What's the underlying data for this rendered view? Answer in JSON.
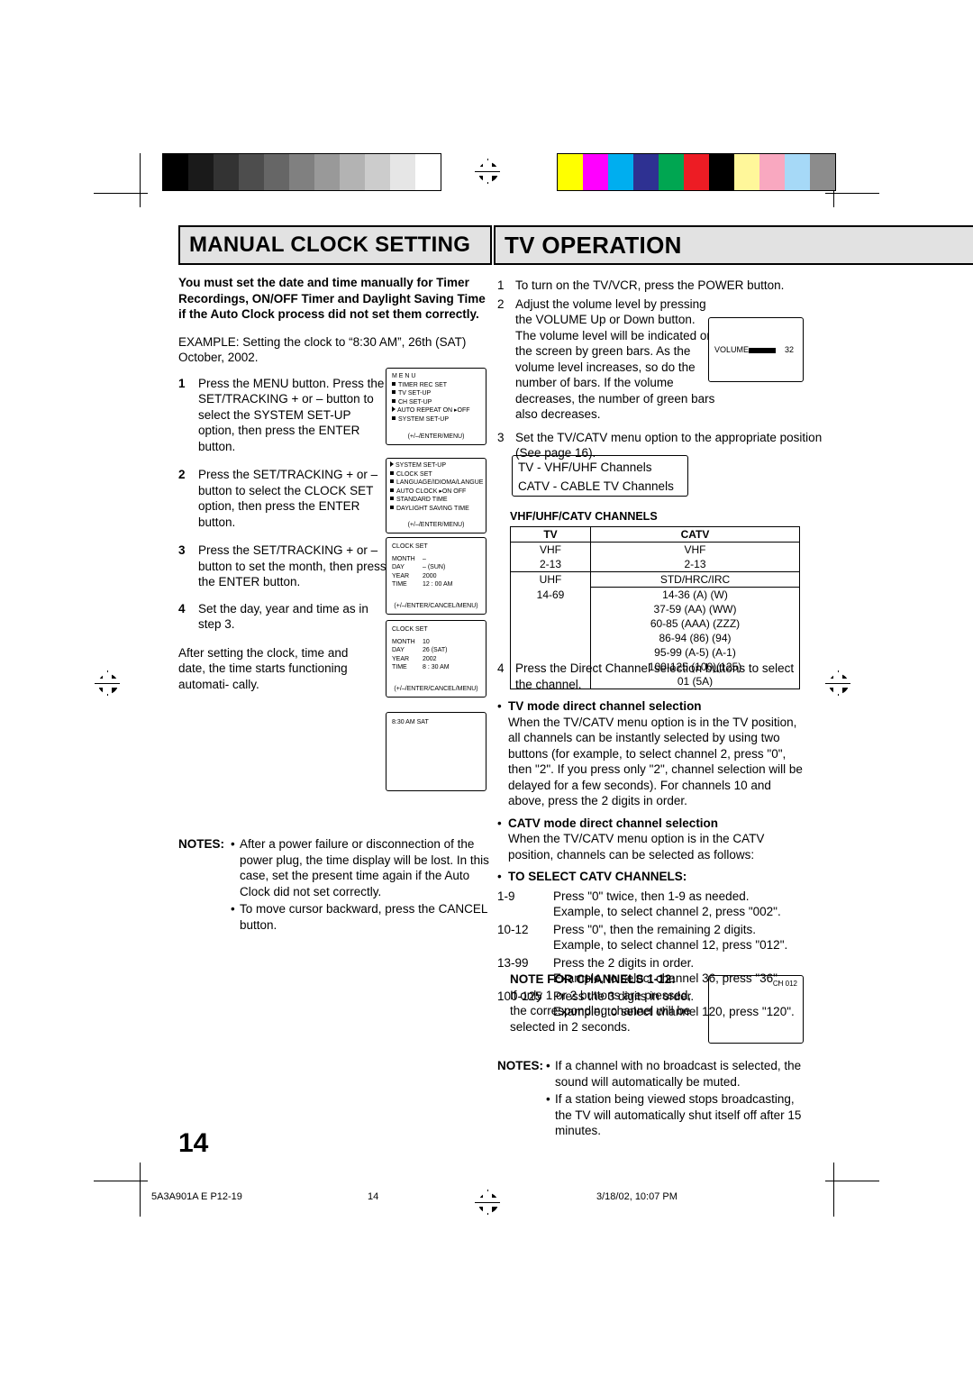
{
  "headers": {
    "left": "MANUAL CLOCK SETTING",
    "right": "TV OPERATION"
  },
  "left_column": {
    "intro": "You must set the date and time manually for Timer Recordings, ON/OFF Timer and Daylight Saving Time if the Auto Clock process did not set them correctly.",
    "example": "EXAMPLE: Setting the clock to “8:30 AM”, 26th (SAT) October, 2002.",
    "steps": [
      {
        "n": "1",
        "text": "Press the MENU button. Press the SET/TRACKING + or – button to select the SYSTEM SET-UP option, then press  the ENTER button."
      },
      {
        "n": "2",
        "text": "Press the SET/TRACKING + or – button to select the CLOCK SET option, then press  the ENTER button."
      },
      {
        "n": "3",
        "text": "Press the SET/TRACKING + or – button to set the month,  then press the ENTER button."
      },
      {
        "n": "4",
        "text": "Set the day, year and time as in step 3."
      }
    ],
    "after": "After setting the clock, time and date, the time starts functioning automati- cally.",
    "notes_label": "NOTES:",
    "notes": [
      "After a power failure or disconnection of the power plug, the time display will be lost. In this case, set the present time again if the Auto Clock did not set correctly.",
      "To move cursor backward, press the CANCEL button."
    ]
  },
  "osd": {
    "menu": {
      "title": "M E N U",
      "lines": [
        "TIMER REC SET",
        "TV SET-UP",
        "CH SET-UP",
        "AUTO REPEAT  ON ▸OFF",
        "SYSTEM  SET-UP"
      ],
      "footer": "(+/–/ENTER/MENU)"
    },
    "system": {
      "title": "SYSTEM  SET-UP",
      "lines": [
        "CLOCK SET",
        "LANGUAGE/IDIOMA/LANGUE",
        "AUTO CLOCK  ▸ON   OFF",
        "STANDARD  TIME",
        "DAYLIGHT  SAVING  TIME"
      ],
      "footer": "(+/–/ENTER/MENU)"
    },
    "clock1": {
      "title": "CLOCK SET",
      "rows": [
        [
          "MONTH",
          "–"
        ],
        [
          "DAY",
          "– (SUN)"
        ],
        [
          "YEAR",
          "2000"
        ],
        [
          "TIME",
          "12 : 00 AM"
        ]
      ],
      "footer": "(+/–/ENTER/CANCEL/MENU)"
    },
    "clock2": {
      "title": "CLOCK SET",
      "rows": [
        [
          "MONTH",
          "10"
        ],
        [
          "DAY",
          "26 (SAT)"
        ],
        [
          "YEAR",
          "2002"
        ],
        [
          "TIME",
          "8 : 30 AM"
        ]
      ],
      "footer": "(+/–/ENTER/CANCEL/MENU)"
    },
    "timeonly": "8:30 AM  SAT"
  },
  "right_column": {
    "steps": [
      {
        "n": "1",
        "text": "To turn on the TV/VCR, press the POWER button."
      },
      {
        "n": "2",
        "text": "Adjust the volume level by pressing the VOLUME Up or Down button. The volume level will be indicated on the screen by green bars. As the volume level increases, so do the number of bars. If the volume decreases, the number of green bars also decreases."
      },
      {
        "n": "3",
        "text": "Set the TV/CATV menu option to the appropriate position (See page 16)."
      }
    ],
    "volume_osd": {
      "label": "VOLUME",
      "value": "32"
    },
    "tv_catv_box": [
      "TV      - VHF/UHF Channels",
      "CATV  - CABLE TV Channels"
    ],
    "table_title": "VHF/UHF/CATV CHANNELS",
    "table": {
      "headers": [
        "TV",
        "CATV"
      ],
      "rows": [
        [
          "VHF",
          "VHF"
        ],
        [
          "2-13",
          "2-13"
        ],
        [
          "UHF",
          "STD/HRC/IRC"
        ],
        [
          "14-69",
          "14-36   (A)  (W)"
        ],
        [
          "",
          "37-59  (AA)  (WW)"
        ],
        [
          "",
          "60-85   (AAA)  (ZZZ)"
        ],
        [
          "",
          "86-94   (86)  (94)"
        ],
        [
          "",
          "95-99   (A-5)  (A-1)"
        ],
        [
          "",
          "100-125  (100)(125)"
        ],
        [
          "",
          "01   (5A)"
        ]
      ]
    },
    "step4": {
      "n": "4",
      "text": "Press the Direct Channel selection buttons to select the channel."
    },
    "tv_mode_title": "TV mode direct channel selection",
    "tv_mode_text": "When the TV/CATV menu option is in the TV position, all channels can be instantly selected by using two buttons (for example, to select channel 2, press \"0\", then \"2\". If you press only \"2\", channel selection will be delayed for a few seconds). For channels 10 and above, press the 2 digits in order.",
    "catv_mode_title": "CATV mode direct channel selection",
    "catv_mode_text": "When the TV/CATV menu option is in the CATV position, channels can be selected as follows:",
    "select_title": "TO SELECT CATV CHANNELS:",
    "select_rows": [
      {
        "key": "1-9",
        "lines": [
          "Press \"0\" twice, then 1-9 as needed.",
          "Example, to select channel 2, press \"002\"."
        ]
      },
      {
        "key": "10-12",
        "lines": [
          "Press \"0\", then the remaining 2 digits.",
          "Example, to select channel 12, press \"012\"."
        ]
      },
      {
        "key": "13-99",
        "lines": [
          "Press the 2 digits in order.",
          "Example, to select  channel 36, press \"36\"."
        ]
      },
      {
        "key": "100-125",
        "lines": [
          "Press the 3 digits in order.",
          "Example, to select channel 120, press \"120\"."
        ]
      }
    ],
    "note_channels_title": "NOTE FOR CHANNELS 1-12:",
    "note_channels_text": "If only 1 or 2 buttons are pressed, the corresponding channel will be selected in 2 seconds.",
    "ch_osd": "CH 012",
    "notes_label": "NOTES:",
    "notes": [
      "If a channel with no broadcast is selected, the sound will automatically be muted.",
      "If a station being viewed stops broadcasting, the TV will automatically shut itself off after 15 minutes."
    ]
  },
  "page_number": "14",
  "footer": {
    "left": "5A3A901A E P12-19",
    "center": "14",
    "right": "3/18/02, 10:07 PM"
  },
  "colors": {
    "gray_bar": [
      "#000000",
      "#1a1a1a",
      "#333333",
      "#4d4d4d",
      "#666666",
      "#808080",
      "#999999",
      "#b3b3b3",
      "#cccccc",
      "#e6e6e6",
      "#ffffff"
    ],
    "color_bar": [
      "#ffff00",
      "#ff00ff",
      "#00aeef",
      "#2e3192",
      "#00a651",
      "#ed1c24",
      "#000000",
      "#fff79a",
      "#f9a8c0",
      "#a6d9f7",
      "#8c8c8c"
    ]
  }
}
